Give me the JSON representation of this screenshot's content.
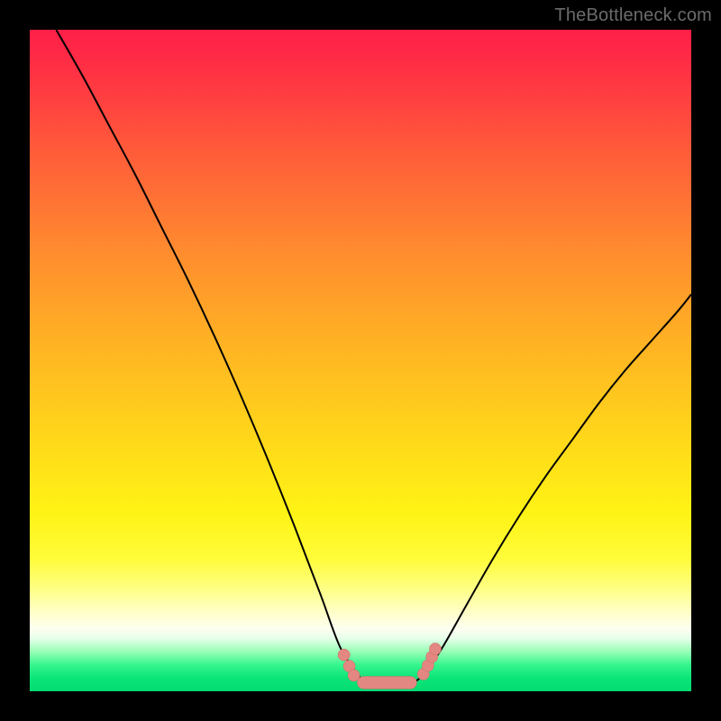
{
  "watermark": "TheBottleneck.com",
  "colors": {
    "curve": "#000000",
    "marker_fill": "#e38782",
    "marker_stroke": "#cf6c66"
  },
  "chart_data": {
    "type": "line",
    "title": "",
    "xlabel": "",
    "ylabel": "",
    "xlim": [
      0,
      100
    ],
    "ylim": [
      0,
      100
    ],
    "grid": false,
    "legend": false,
    "series": [
      {
        "name": "left-branch",
        "x": [
          4,
          8,
          12,
          16,
          20,
          24,
          28,
          32,
          36,
          40,
          44,
          47,
          50
        ],
        "y": [
          100,
          93,
          85.5,
          78,
          70,
          62,
          53.5,
          44.5,
          35,
          25,
          14.5,
          6.5,
          2
        ]
      },
      {
        "name": "right-branch",
        "x": [
          59,
          62,
          66,
          70,
          74,
          78,
          82,
          86,
          90,
          94,
          98,
          100
        ],
        "y": [
          2,
          6,
          13,
          20,
          26.5,
          32.5,
          38,
          43.5,
          48.5,
          53,
          57.5,
          60
        ]
      },
      {
        "name": "valley-floor",
        "x": [
          50,
          52,
          54,
          56,
          58,
          59
        ],
        "y": [
          2,
          1.4,
          1.2,
          1.2,
          1.4,
          2
        ]
      }
    ],
    "markers": [
      {
        "x": 47.5,
        "y": 5.5,
        "r": 0.9
      },
      {
        "x": 48.3,
        "y": 3.8,
        "r": 0.9
      },
      {
        "x": 49.0,
        "y": 2.4,
        "r": 0.9
      },
      {
        "x": 59.5,
        "y": 2.6,
        "r": 0.9
      },
      {
        "x": 60.2,
        "y": 3.9,
        "r": 0.9
      },
      {
        "x": 60.8,
        "y": 5.2,
        "r": 0.9
      },
      {
        "x": 61.3,
        "y": 6.4,
        "r": 0.9
      }
    ],
    "valley_bar": {
      "x0": 49.5,
      "x1": 58.5,
      "y": 1.3,
      "thickness": 1.9
    }
  }
}
